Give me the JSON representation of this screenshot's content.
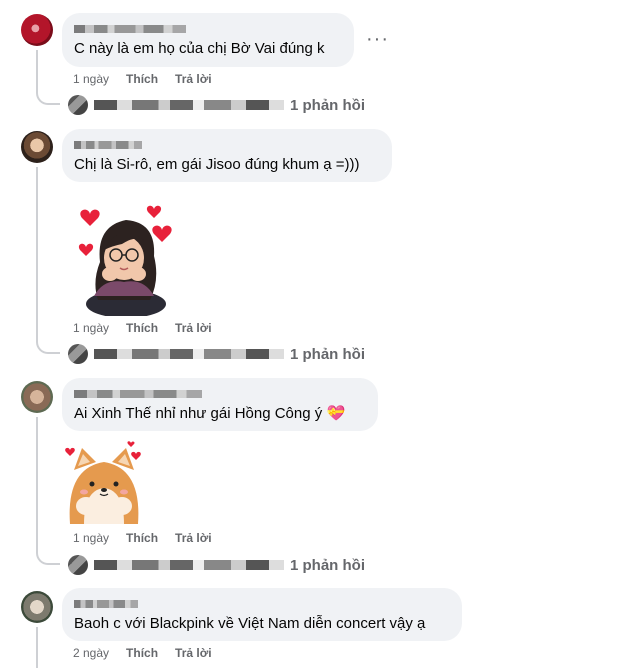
{
  "comments": [
    {
      "text": "C này là em họ của chị Bờ Vai đúng k",
      "time": "1 ngày",
      "like": "Thích",
      "reply": "Trả lời",
      "replies": "1 phản hồi",
      "more": "···"
    },
    {
      "text": "Chị là Si-rô, em gái Jisoo đúng khum ạ =)))",
      "time": "1 ngày",
      "like": "Thích",
      "reply": "Trả lời",
      "replies": "1 phản hồi",
      "sticker": "girl-hearts-sticker"
    },
    {
      "text": "Ai Xinh Thế nhỉ như gái Hồng Công ý",
      "emoji": "💝",
      "time": "1 ngày",
      "like": "Thích",
      "reply": "Trả lời",
      "replies": "1 phản hồi",
      "sticker": "shiba-dog-hearts-sticker"
    },
    {
      "text": "Baoh c với Blackpink về Việt Nam diễn concert vậy ạ",
      "time": "2 ngày",
      "like": "Thích",
      "reply": "Trả lời"
    }
  ],
  "colors": {
    "bubble": "#f0f2f5",
    "meta": "#65676b",
    "thread": "#ced0d4"
  }
}
